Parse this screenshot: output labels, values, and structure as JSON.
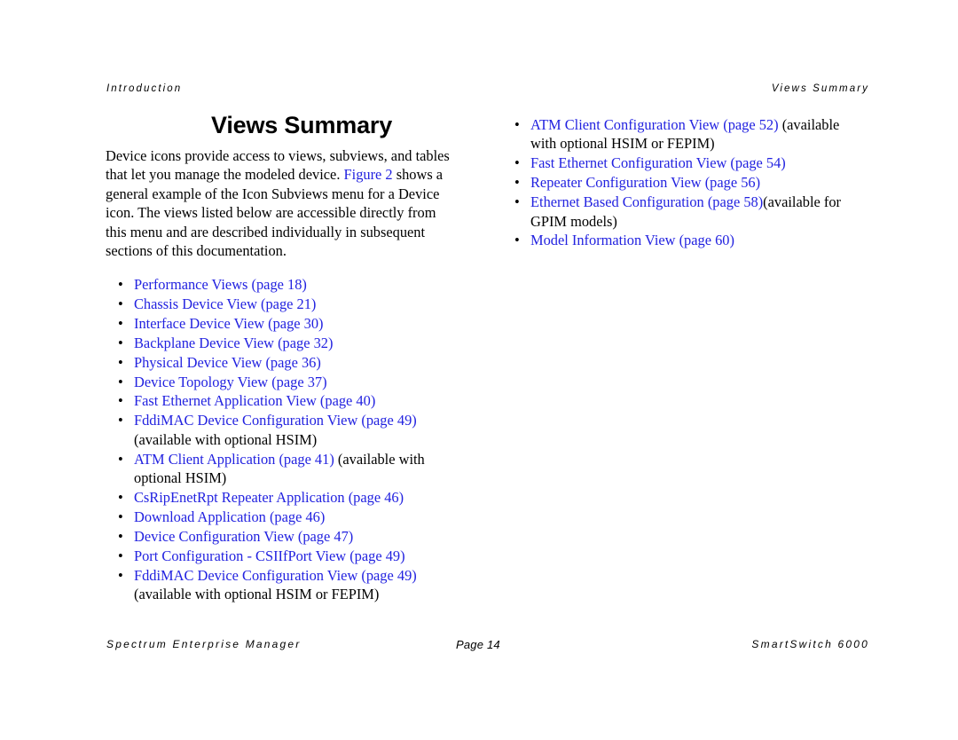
{
  "document": {
    "running_head_left": "Introduction",
    "running_head_right": "Views Summary",
    "title": "Views Summary"
  },
  "intro": {
    "text_part1": "Device icons provide access to views, subviews, and tables that let you manage the modeled device. ",
    "figure_link": "Figure 2",
    "text_part2": " shows a general example of the Icon Subviews menu for a Device icon. The views listed below are accessible directly from this menu and are described individually in subsequent sections of this documentation."
  },
  "bullet_glyph": "•",
  "left_column": {
    "items": [
      {
        "link": "Performance Views (page 18)",
        "note": ""
      },
      {
        "link": "Chassis Device View (page 21)",
        "note": ""
      },
      {
        "link": "Interface Device View (page 30)",
        "note": ""
      },
      {
        "link": "Backplane Device View (page 32)",
        "note": ""
      },
      {
        "link": "Physical Device View (page 36)",
        "note": ""
      },
      {
        "link": "Device Topology View (page 37)",
        "note": ""
      },
      {
        "link": "Fast Ethernet Application View (page 40)",
        "note": ""
      },
      {
        "link": "FddiMAC Device Configuration View (page 49)",
        "note": " (available with optional HSIM)"
      },
      {
        "link": "ATM Client Application (page 41)",
        "note": " (available with optional HSIM)"
      },
      {
        "link": "CsRipEnetRpt Repeater Application (page 46)",
        "note": ""
      },
      {
        "link": "Download Application (page 46)",
        "note": ""
      },
      {
        "link": "Device Configuration View (page 47)",
        "note": ""
      },
      {
        "link": "Port Configuration - CSIIfPort View (page 49)",
        "note": ""
      },
      {
        "link": "FddiMAC Device Configuration View (page 49)",
        "note": " (available with optional HSIM or FEPIM)"
      }
    ]
  },
  "right_column": {
    "items": [
      {
        "link": "ATM Client Configuration View (page 52)",
        "note": " (available with optional HSIM or FEPIM)"
      },
      {
        "link": "Fast Ethernet Configuration View (page 54)",
        "note": ""
      },
      {
        "link": "Repeater Configuration View (page 56)",
        "note": ""
      },
      {
        "link": "Ethernet Based Configuration (page 58)",
        "note": "(available for GPIM models)"
      },
      {
        "link": "Model Information View (page 60)",
        "note": ""
      }
    ]
  },
  "footer": {
    "left": "Spectrum Enterprise Manager",
    "center": "Page 14",
    "right": "SmartSwitch 6000"
  },
  "colors": {
    "link": "#2222E0",
    "text": "#000000",
    "background": "#FFFFFF"
  }
}
